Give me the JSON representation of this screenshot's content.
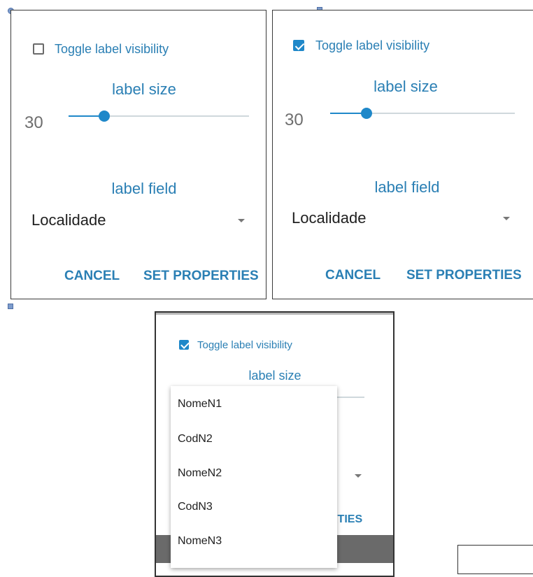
{
  "colors": {
    "accent": "#1f88c9",
    "text_accent": "#2a7fb4",
    "handle": "#7d9ccc"
  },
  "dialog_a": {
    "checkbox": {
      "label": "Toggle label visibility",
      "checked": false
    },
    "label_size": {
      "heading": "label size",
      "value": "30",
      "slider_fraction": 0.2
    },
    "label_field": {
      "heading": "label field",
      "selected": "Localidade"
    },
    "buttons": {
      "cancel": "CANCEL",
      "set_properties": "SET PROPERTIES"
    }
  },
  "dialog_b": {
    "checkbox": {
      "label": "Toggle label visibility",
      "checked": true
    },
    "label_size": {
      "heading": "label size",
      "value": "30",
      "slider_fraction": 0.2
    },
    "label_field": {
      "heading": "label field",
      "selected": "Localidade"
    },
    "buttons": {
      "cancel": "CANCEL",
      "set_properties": "SET PROPERTIES"
    }
  },
  "dialog_c": {
    "checkbox": {
      "label": "Toggle label visibility",
      "checked": true
    },
    "label_size": {
      "heading": "label size"
    },
    "partial_button": "RTIES",
    "dropdown_options": [
      "NomeN1",
      "CodN2",
      "NomeN2",
      "CodN3",
      "NomeN3"
    ]
  }
}
